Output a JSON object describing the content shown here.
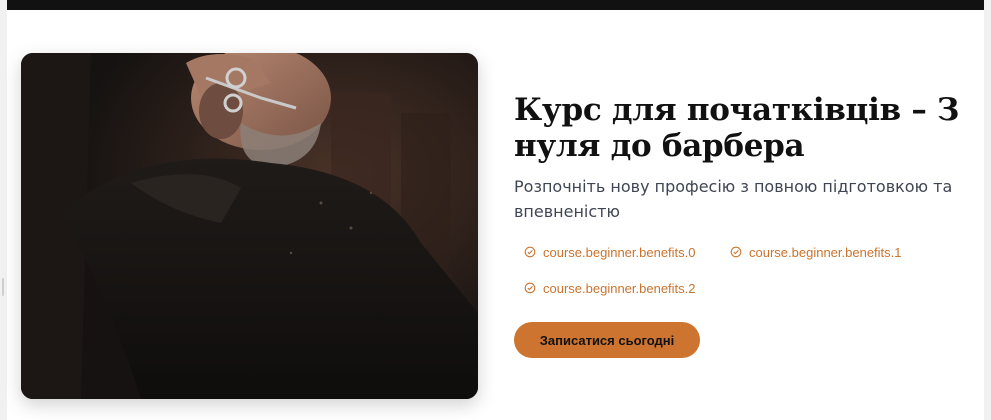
{
  "course": {
    "title": "Курс для початківців – З нуля до барбера",
    "subtitle": "Розпочніть нову професію з повною підготовкою та впевненістю",
    "benefits": [
      {
        "label": "course.beginner.benefits.0",
        "icon": "check-circle-icon"
      },
      {
        "label": "course.beginner.benefits.1",
        "icon": "check-circle-icon"
      },
      {
        "label": "course.beginner.benefits.2",
        "icon": "check-circle-icon"
      }
    ],
    "cta_label": "Записатися сьогодні",
    "image_icon": "barber-photo"
  },
  "colors": {
    "accent": "#cd7431",
    "benefit_text": "#c8742f",
    "title": "#111111",
    "subtitle": "#3f4653",
    "top_bar": "#111111"
  }
}
